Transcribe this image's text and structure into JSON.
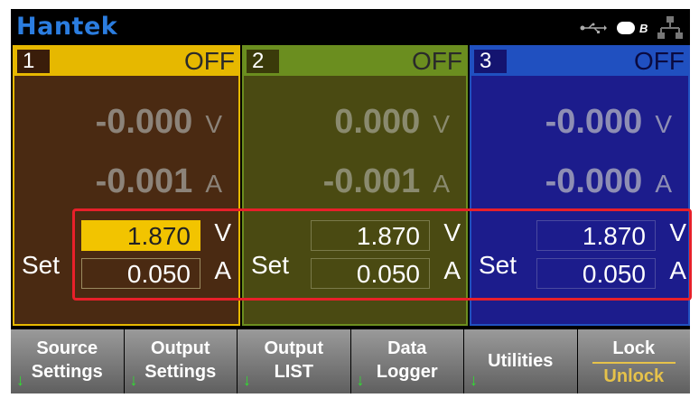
{
  "brand": "Hantek",
  "icons": {
    "usb": "usb-icon",
    "lock_toggle": "toggle-b-icon",
    "network": "network-icon"
  },
  "toggle_label": "B",
  "channels": [
    {
      "number": "1",
      "state": "OFF",
      "measured_voltage": "-0.000",
      "voltage_unit": "V",
      "measured_current": "-0.001",
      "current_unit": "A",
      "set_label": "Set",
      "set_voltage": "1.870",
      "set_voltage_unit": "V",
      "set_current": "0.050",
      "set_current_unit": "A",
      "color": "#e6b800"
    },
    {
      "number": "2",
      "state": "OFF",
      "measured_voltage": "0.000",
      "voltage_unit": "V",
      "measured_current": "-0.001",
      "current_unit": "A",
      "set_label": "Set",
      "set_voltage": "1.870",
      "set_voltage_unit": "V",
      "set_current": "0.050",
      "set_current_unit": "A",
      "color": "#6b8e1f"
    },
    {
      "number": "3",
      "state": "OFF",
      "measured_voltage": "-0.000",
      "voltage_unit": "V",
      "measured_current": "-0.000",
      "current_unit": "A",
      "set_label": "Set",
      "set_voltage": "1.870",
      "set_voltage_unit": "V",
      "set_current": "0.050",
      "set_current_unit": "A",
      "color": "#2050c0"
    }
  ],
  "softkeys": [
    {
      "line1": "Source",
      "line2": "Settings"
    },
    {
      "line1": "Output",
      "line2": "Settings"
    },
    {
      "line1": "Output",
      "line2": "LIST"
    },
    {
      "line1": "Data",
      "line2": "Logger"
    },
    {
      "label": "Utilities"
    },
    {
      "top": "Lock",
      "bottom": "Unlock"
    }
  ],
  "softkey_arrow": "↓"
}
